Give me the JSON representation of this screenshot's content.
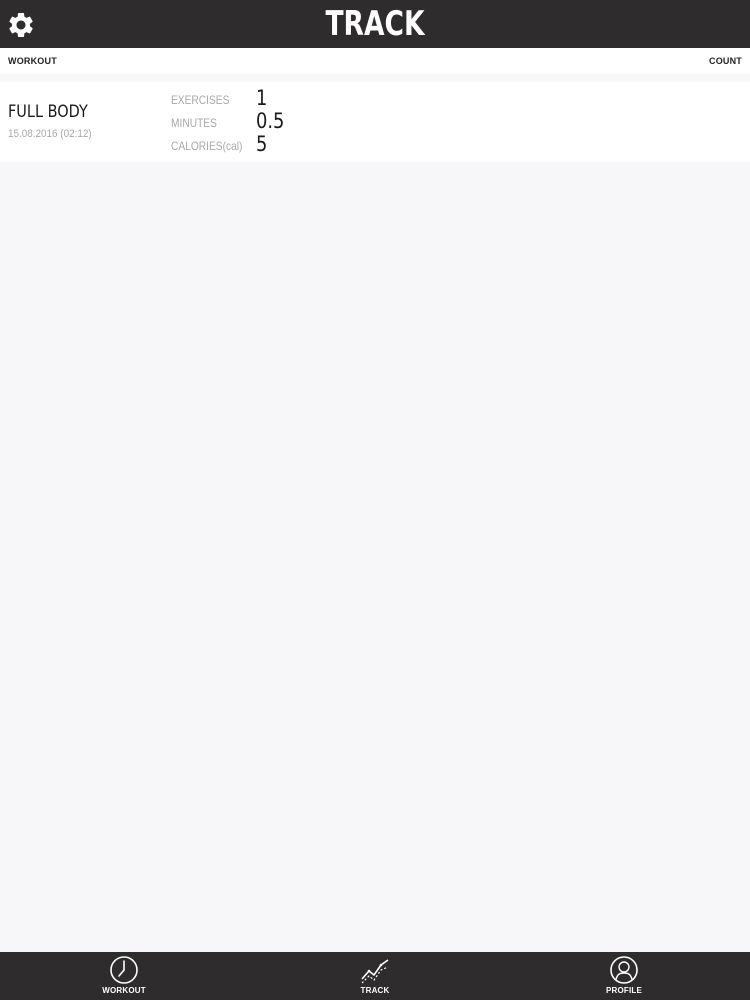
{
  "header": {
    "title": "TRACK",
    "settings_icon": "gear-icon"
  },
  "columns": {
    "left": "WORKOUT",
    "right": "COUNT"
  },
  "workouts": [
    {
      "name": "FULL BODY",
      "date": "15.08.2016 (02:12)",
      "stats": [
        {
          "label": "EXERCISES",
          "value": "1"
        },
        {
          "label": "MINUTES",
          "value": "0.5"
        },
        {
          "label": "CALORIES(cal)",
          "value": "5"
        }
      ]
    }
  ],
  "tabs": [
    {
      "label": "WORKOUT",
      "icon": "clock-icon"
    },
    {
      "label": "TRACK",
      "icon": "chart-line-icon",
      "active": true
    },
    {
      "label": "PROFILE",
      "icon": "profile-icon"
    }
  ],
  "colors": {
    "bar_background": "#2e2c2d",
    "page_background": "#f7f6f8",
    "row_background": "#ffffff",
    "muted_text": "#a8a8a8"
  }
}
